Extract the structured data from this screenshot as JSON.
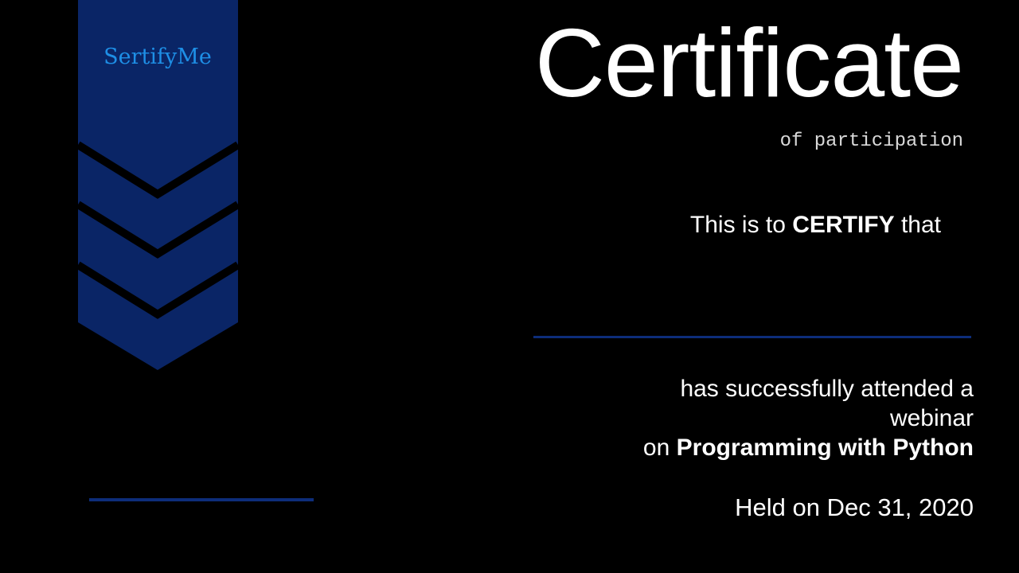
{
  "brand": {
    "name": "SertifyMe",
    "color": "#1e8fe6"
  },
  "accent_color": "#0a2566",
  "certificate": {
    "title": "Certificate",
    "subtitle": "of participation",
    "certify_prefix": "This is to",
    "certify_emphasis": "CERTIFY",
    "certify_suffix": "that",
    "recipient_name": "",
    "attended_text": "has successfully attended a webinar",
    "topic_prefix": "on",
    "topic": "Programming with Python",
    "held_text": "Held on Dec 31, 2020"
  }
}
